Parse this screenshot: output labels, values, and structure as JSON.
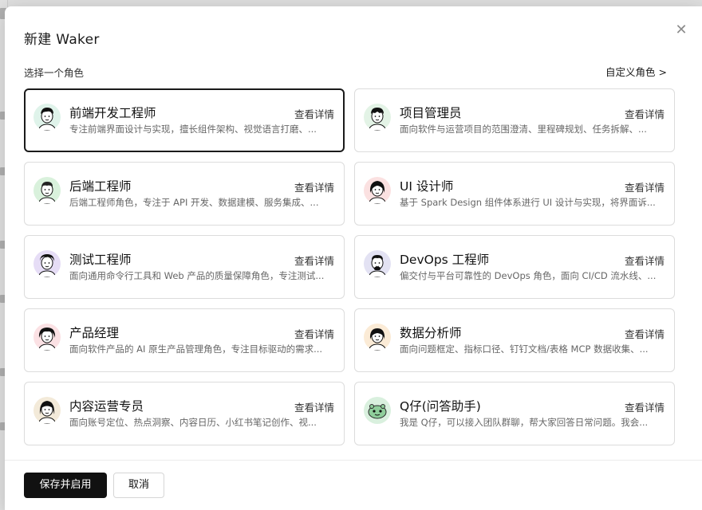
{
  "modal": {
    "title": "新建 Waker",
    "close_icon": "close-icon",
    "section_label": "选择一个角色",
    "custom_role_link": "自定义角色 >"
  },
  "roles": [
    {
      "name": "前端开发工程师",
      "detail": "查看详情",
      "desc": "专注前端界面设计与实现，擅长组件架构、视觉语言打磨、...",
      "avatar": "avatar-frontend",
      "avatar_bg": "#dff3ea",
      "selected": true
    },
    {
      "name": "项目管理员",
      "detail": "查看详情",
      "desc": "面向软件与运营项目的范围澄清、里程碑规划、任务拆解、...",
      "avatar": "avatar-pm",
      "avatar_bg": "#e3f3e6",
      "selected": false
    },
    {
      "name": "后端工程师",
      "detail": "查看详情",
      "desc": "后端工程师角色，专注于 API 开发、数据建模、服务集成、...",
      "avatar": "avatar-backend",
      "avatar_bg": "#d9f1dc",
      "selected": false
    },
    {
      "name": "UI 设计师",
      "detail": "查看详情",
      "desc": "基于 Spark Design 组件体系进行 UI 设计与实现，将界面诉...",
      "avatar": "avatar-ui",
      "avatar_bg": "#fbe1e1",
      "selected": false
    },
    {
      "name": "测试工程师",
      "detail": "查看详情",
      "desc": "面向通用命令行工具和 Web 产品的质量保障角色，专注测试...",
      "avatar": "avatar-qa",
      "avatar_bg": "#e6ddf6",
      "selected": false
    },
    {
      "name": "DevOps 工程师",
      "detail": "查看详情",
      "desc": "偏交付与平台可靠性的 DevOps 角色，面向 CI/CD 流水线、...",
      "avatar": "avatar-devops",
      "avatar_bg": "#e3e2f3",
      "selected": false
    },
    {
      "name": "产品经理",
      "detail": "查看详情",
      "desc": "面向软件产品的 AI 原生产品管理角色，专注目标驱动的需求...",
      "avatar": "avatar-product",
      "avatar_bg": "#fbe1e4",
      "selected": false
    },
    {
      "name": "数据分析师",
      "detail": "查看详情",
      "desc": "面向问题框定、指标口径、钉钉文档/表格 MCP 数据收集、...",
      "avatar": "avatar-data",
      "avatar_bg": "#fbebd6",
      "selected": false
    },
    {
      "name": "内容运营专员",
      "detail": "查看详情",
      "desc": "面向账号定位、热点洞察、内容日历、小红书笔记创作、视...",
      "avatar": "avatar-content",
      "avatar_bg": "#f3ead9",
      "selected": false
    },
    {
      "name": "Q仔(问答助手)",
      "detail": "查看详情",
      "desc": "我是 Q仔，可以接入团队群聊，帮大家回答日常问题。我会...",
      "avatar": "avatar-qa-bot",
      "avatar_bg": "#d9f0de",
      "selected": false
    }
  ],
  "footer": {
    "primary_button": "保存并启用",
    "cancel_button": "取消"
  }
}
